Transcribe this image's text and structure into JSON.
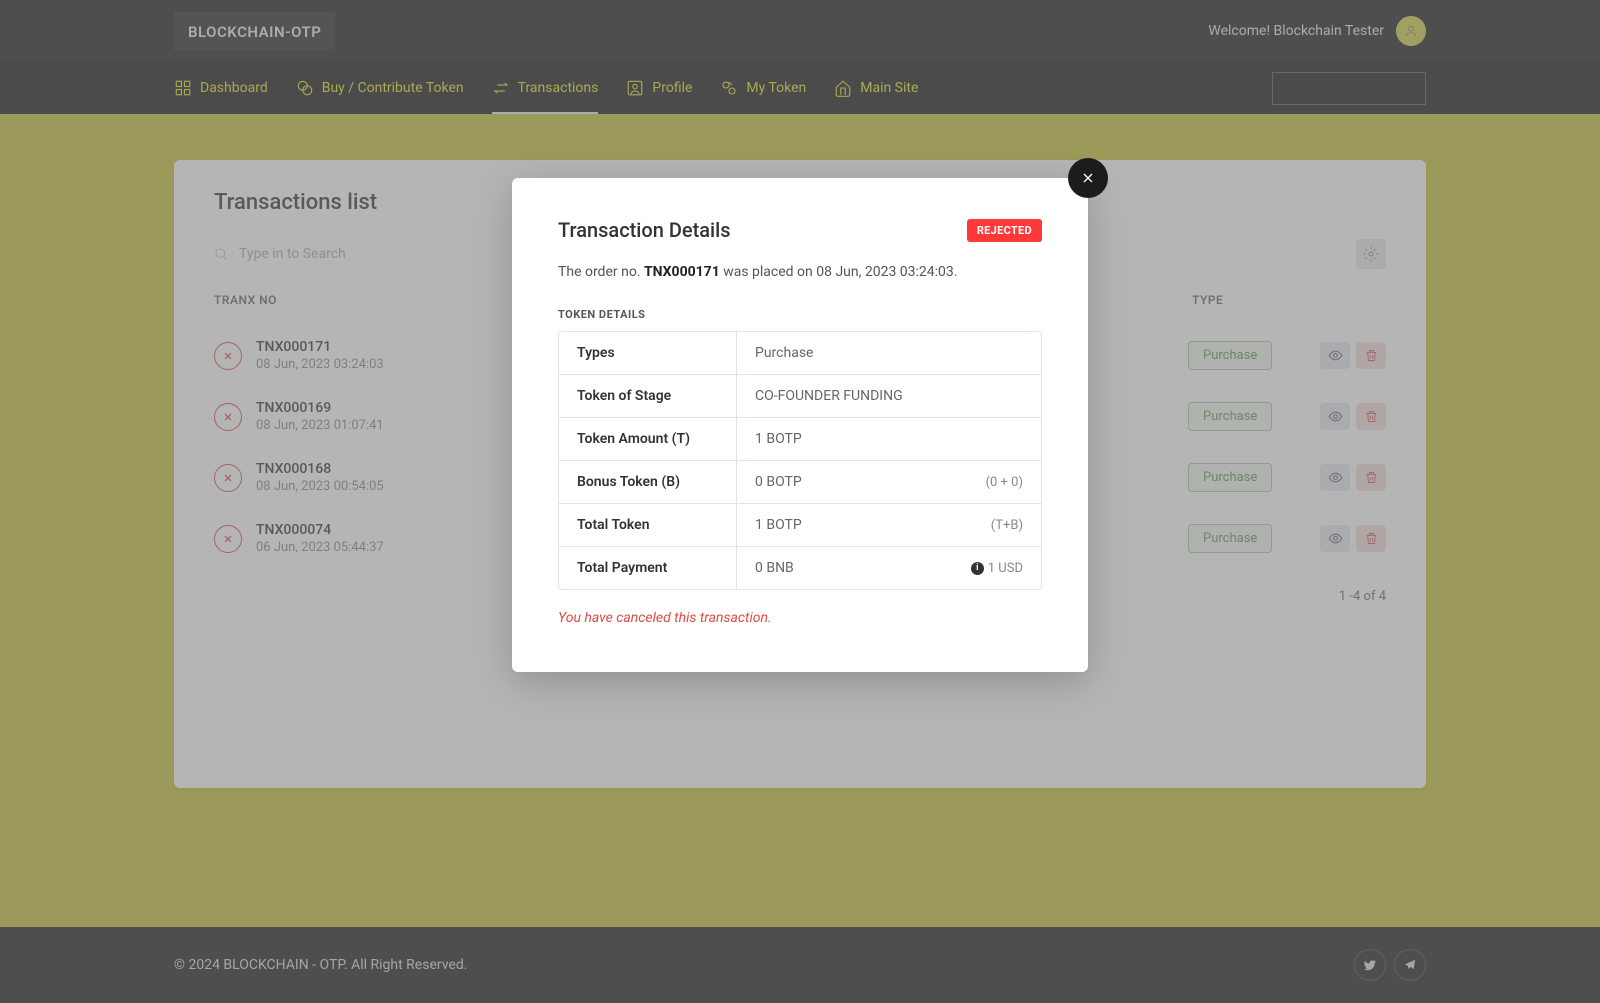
{
  "brand": "BLOCKCHAIN-OTP",
  "welcome": "Welcome! Blockchain Tester",
  "nav": {
    "dashboard": "Dashboard",
    "buy": "Buy / Contribute Token",
    "transactions": "Transactions",
    "profile": "Profile",
    "mytoken": "My Token",
    "mainsite": "Main Site"
  },
  "page": {
    "title": "Transactions list",
    "search_placeholder": "Type in to Search",
    "col_tranx": "TRANX NO",
    "col_type": "TYPE",
    "pagination": "1 -4 of 4"
  },
  "transactions": [
    {
      "id": "TNX000171",
      "date": "08 Jun, 2023 03:24:03",
      "type": "Purchase"
    },
    {
      "id": "TNX000169",
      "date": "08 Jun, 2023 01:07:41",
      "type": "Purchase"
    },
    {
      "id": "TNX000168",
      "date": "08 Jun, 2023 00:54:05",
      "type": "Purchase"
    },
    {
      "id": "TNX000074",
      "date": "06 Jun, 2023 05:44:37",
      "type": "Purchase"
    }
  ],
  "modal": {
    "title": "Transaction Details",
    "status": "REJECTED",
    "order_pre": "The order no. ",
    "order_no": "TNX000171",
    "order_post": " was placed on 08 Jun, 2023 03:24:03.",
    "section": "TOKEN DETAILS",
    "rows": {
      "types_k": "Types",
      "types_v": "Purchase",
      "stage_k": "Token of Stage",
      "stage_v": "CO-FOUNDER FUNDING",
      "amount_k": "Token Amount (T)",
      "amount_v": "1 BOTP",
      "bonus_k": "Bonus Token (B)",
      "bonus_v": "0 BOTP",
      "bonus_extra": "(0 + 0)",
      "total_k": "Total Token",
      "total_v": "1 BOTP",
      "total_extra": "(T+B)",
      "pay_k": "Total Payment",
      "pay_v": "0 BNB",
      "pay_extra": "1 USD"
    },
    "cancel_msg": "You have canceled this transaction."
  },
  "footer": "© 2024 BLOCKCHAIN - OTP. All Right Reserved."
}
